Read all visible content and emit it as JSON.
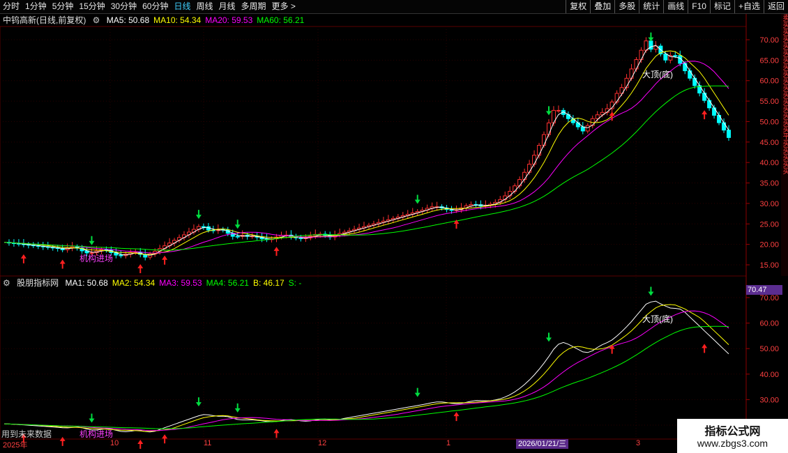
{
  "toolbar": {
    "periods": [
      "分时",
      "1分钟",
      "5分钟",
      "15分钟",
      "30分钟",
      "60分钟",
      "日线",
      "周线",
      "月线",
      "多周期",
      "更多 >"
    ],
    "active_period": "日线",
    "actions": [
      "复权",
      "叠加",
      "多股",
      "统计",
      "画线",
      "F10",
      "标记",
      "+自选",
      "返回"
    ]
  },
  "main_panel": {
    "title": "中钨高新(日线,前复权)",
    "ma": [
      {
        "label": "MA5: 50.68",
        "color": "#ffffff"
      },
      {
        "label": "MA10: 54.34",
        "color": "#ffff00"
      },
      {
        "label": "MA20: 59.53",
        "color": "#ff00ff"
      },
      {
        "label": "MA60: 56.21",
        "color": "#00ff00"
      }
    ],
    "y_ticks": [
      "70.00",
      "65.00",
      "60.00",
      "55.00",
      "50.00",
      "45.00",
      "40.00",
      "35.00",
      "30.00",
      "25.00",
      "20.00",
      "15.00"
    ],
    "annotations": {
      "top_label": "大顶(底)",
      "entry_label": "机构进场"
    }
  },
  "sub_panel": {
    "title": "股朋指标网",
    "ma": [
      {
        "label": "MA1: 50.68",
        "color": "#ffffff"
      },
      {
        "label": "MA2: 54.34",
        "color": "#ffff00"
      },
      {
        "label": "MA3: 59.53",
        "color": "#ff00ff"
      },
      {
        "label": "MA4: 56.21",
        "color": "#00ff00"
      },
      {
        "label": "B: 46.17",
        "color": "#ffff00"
      },
      {
        "label": "S: -",
        "color": "#00ff00"
      }
    ],
    "y_ticks": [
      "70.00",
      "60.00",
      "50.00",
      "40.00",
      "30.00",
      "20.00"
    ],
    "current_value": "70.47",
    "annotations": {
      "top_label": "大顶(底)",
      "entry_label": "机构进场",
      "footer_text": "用到未来数据"
    }
  },
  "date_axis": {
    "labels": [
      "2025年",
      "10",
      "11",
      "12",
      "1",
      "3"
    ],
    "cursor_date": "2026/01/21/三"
  },
  "right_strip": "卖买买买买买买买买买买买买买买买买平买买买买买",
  "watermark": {
    "line1": "指标公式网",
    "line2": "www.zbgs3.com"
  },
  "colors": {
    "up": "#ff3030",
    "down": "#00ffff",
    "bg": "#000000",
    "grid": "#3a0000"
  }
}
